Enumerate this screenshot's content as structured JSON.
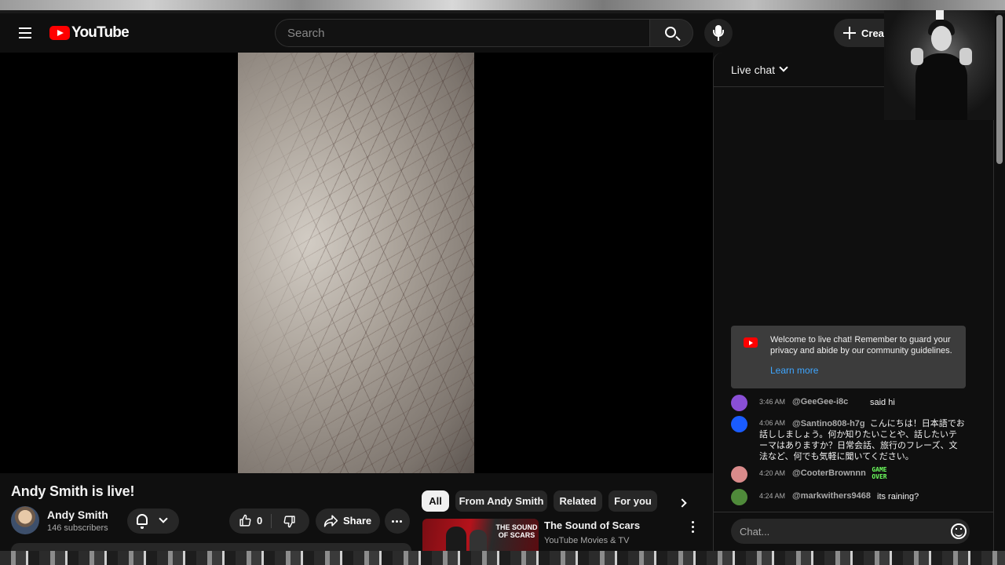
{
  "masthead": {
    "logo_text": "YouTube",
    "search_placeholder": "Search",
    "create_label": "Create"
  },
  "video": {
    "title": "Andy Smith is live!"
  },
  "channel": {
    "name": "Andy Smith",
    "subscribers": "146 subscribers"
  },
  "actions": {
    "like_count": "0",
    "share_label": "Share"
  },
  "chips": [
    "All",
    "From Andy Smith",
    "Related",
    "For you"
  ],
  "related": {
    "title": "The Sound of Scars",
    "channel": "YouTube Movies & TV",
    "thumb_text": "THE SOUND OF SCARS"
  },
  "chat": {
    "title": "Live chat",
    "welcome_text": "Welcome to live chat! Remember to guard your privacy and abide by our community guidelines.",
    "learn_more": "Learn more",
    "input_placeholder": "Chat...",
    "messages": [
      {
        "time": "3:46 AM",
        "author": "@GeeGee-i8c",
        "text": "said hi",
        "avatar_color": "#8a4fd6"
      },
      {
        "time": "4:06 AM",
        "author": "@Santino808-h7g",
        "text": "こんにちは！日本語でお話ししましょう。何か知りたいことや、話したいテーマはありますか？日常会話、旅行のフレーズ、文法など、何でも気軽に聞いてください。",
        "avatar_color": "#1a5cff"
      },
      {
        "time": "4:20 AM",
        "author": "@CooterBrownnn",
        "text": "",
        "emote": "GAME OVER",
        "avatar_color": "#d98b8b"
      },
      {
        "time": "4:24 AM",
        "author": "@markwithers9468",
        "text": "its raining?",
        "avatar_color": "#4f8a3a"
      }
    ]
  },
  "colors": {
    "background": "#0f0f0f",
    "accent_red": "#ff0000",
    "link_blue": "#3ea6ff"
  }
}
